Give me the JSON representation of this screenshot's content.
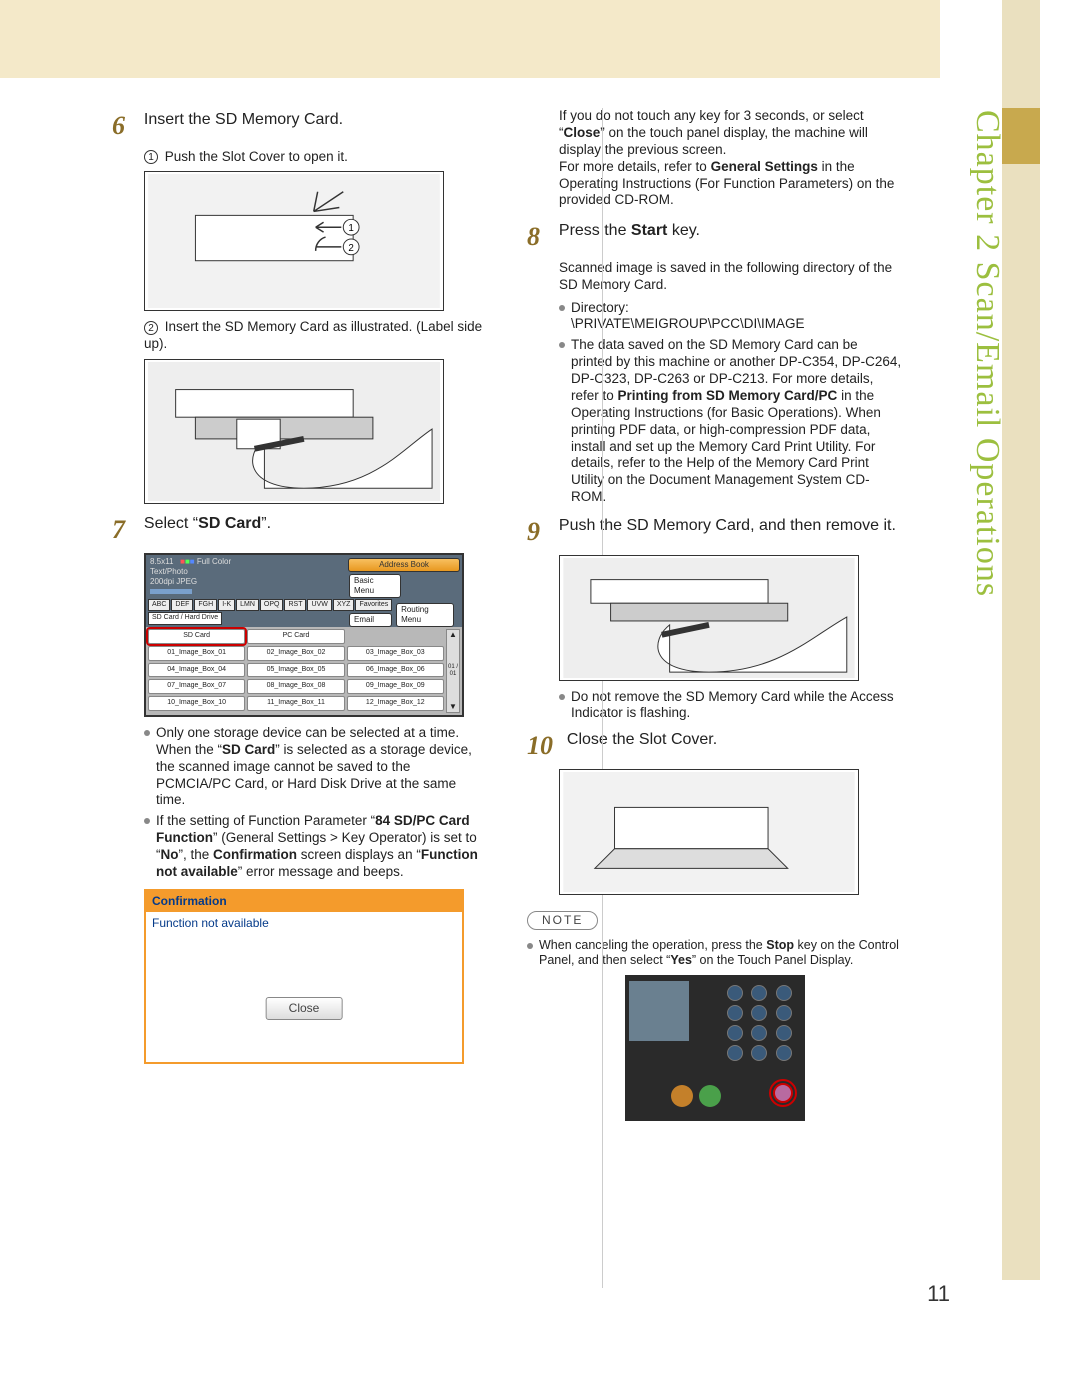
{
  "chapter_tab": "Chapter 2    Scan/Email Operations",
  "page_number": "11",
  "left": {
    "step6": {
      "num": "6",
      "title": "Insert the SD Memory Card.",
      "sub1_circ": "1",
      "sub1": "Push the Slot Cover to open it.",
      "sub2_circ": "2",
      "sub2": "Insert the SD Memory Card as illustrated. (Label side up)."
    },
    "step7": {
      "num": "7",
      "title_pre": "Select “",
      "title_b": "SD Card",
      "title_post": "”.",
      "bullet1_pre": "Only one storage device can be selected at a time. When the “",
      "bullet1_b": "SD Card",
      "bullet1_post": "” is selected as a storage device, the scanned image cannot be saved to the PCMCIA/PC Card, or Hard Disk Drive at the same time.",
      "bullet2_p1": "If the setting of Function Parameter “",
      "bullet2_b1": "84 SD/PC Card Function",
      "bullet2_p2": "” (General Settings > Key Operator) is set to “",
      "bullet2_b2": "No",
      "bullet2_p3": "”, the ",
      "bullet2_b3": "Confirmation",
      "bullet2_p4": " screen displays an “",
      "bullet2_b4": "Function not available",
      "bullet2_p5": "” error message and beeps."
    },
    "tscreen": {
      "status_1": "8.5x11",
      "status_2": "Full Color",
      "status_3": "Text/Photo",
      "status_4": "200dpi JPEG",
      "btn_addr": "Address Book",
      "btn_basic": "Basic Menu",
      "btn_email": "Email",
      "btn_routing": "Routing Menu",
      "tabs": [
        "ABC",
        "DEF",
        "FGH",
        "I-K",
        "LMN",
        "OPQ",
        "RST",
        "UVW",
        "XYZ",
        "Favorites"
      ],
      "tab_last": "SD Card / Hard Drive",
      "grid": [
        [
          "SD Card",
          "PC Card",
          ""
        ],
        [
          "01_Image_Box_01",
          "02_Image_Box_02",
          "03_Image_Box_03"
        ],
        [
          "04_Image_Box_04",
          "05_Image_Box_05",
          "06_Image_Box_06"
        ],
        [
          "07_Image_Box_07",
          "08_Image_Box_08",
          "09_Image_Box_09"
        ],
        [
          "10_Image_Box_10",
          "11_Image_Box_11",
          "12_Image_Box_12"
        ]
      ],
      "scroll_count": "01 / 01"
    },
    "confirm": {
      "title": "Confirmation",
      "msg": "Function not available",
      "close": "Close"
    }
  },
  "right": {
    "carry1_p1": "If you do not touch any key for 3 seconds, or select “",
    "carry1_b": "Close",
    "carry1_p2": "” on the touch panel display, the machine will display the previous screen.",
    "carry2_p1": "For more details, refer to ",
    "carry2_b": "General Settings",
    "carry2_p2": " in the Operating Instructions (For Function Parameters) on the provided CD-ROM.",
    "step8": {
      "num": "8",
      "title_pre": "Press the ",
      "title_b": "Start",
      "title_post": " key.",
      "sub": "Scanned image is saved in the following directory of the SD Memory Card.",
      "b1_label": "Directory:",
      "b1_path": "\\PRIVATE\\MEIGROUP\\PCC\\DI\\IMAGE",
      "b2_p1": "The data saved on the SD Memory Card can be printed by this machine or another DP-C354, DP-C264, DP-C323, DP-C263 or DP-C213. For more details, refer to ",
      "b2_b": "Printing from SD Memory Card/PC",
      "b2_p2": " in the Operating Instructions (for Basic Operations). When printing PDF data, or high-compression PDF data, install and set up the Memory Card Print Utility. For details, refer to the Help of the Memory Card Print Utility on the Document Management System CD-ROM."
    },
    "step9": {
      "num": "9",
      "title": "Push the SD Memory Card, and then remove it.",
      "b1": "Do not remove the SD Memory Card while the Access Indicator is flashing."
    },
    "step10": {
      "num": "10",
      "title": "Close the Slot Cover."
    },
    "note_label": "NOTE",
    "note_p1": "When canceling the operation, press the ",
    "note_b1": "Stop",
    "note_p2": " key on the Control Panel, and then select “",
    "note_b2": "Yes",
    "note_p3": "” on the Touch Panel Display."
  }
}
